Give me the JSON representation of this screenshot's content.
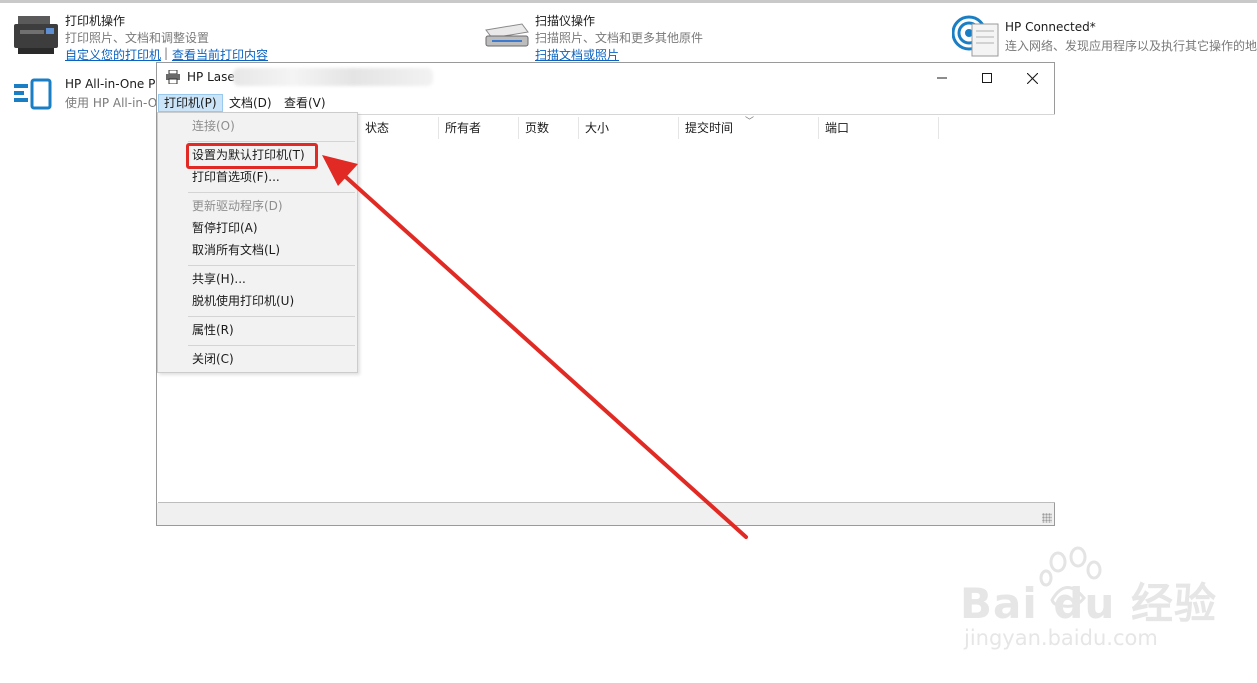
{
  "tiles": {
    "printer_actions": {
      "title": "打印机操作",
      "subtitle": "打印照片、文档和调整设置",
      "link1": "自定义您的打印机",
      "link2": "查看当前打印内容",
      "separator": "|"
    },
    "scanner_actions": {
      "title": "扫描仪操作",
      "subtitle": "扫描照片、文档和更多其他原件",
      "link": "扫描文档或照片"
    },
    "hp_connected": {
      "title": "HP Connected*",
      "subtitle": "连入网络、发现应用程序以及执行其它操作的地"
    },
    "hp_allinone": {
      "title": "HP All-in-One P",
      "subtitle": "使用 HP All-in-O"
    }
  },
  "window": {
    "title": "HP Lase",
    "controls": {
      "minimize": "minimize-icon",
      "maximize": "maximize-icon",
      "close": "close-icon"
    },
    "menus": [
      "打印机(P)",
      "文档(D)",
      "查看(V)"
    ],
    "columns": [
      "状态",
      "所有者",
      "页数",
      "大小",
      "提交时间",
      "端口"
    ]
  },
  "dropdown": {
    "items": [
      {
        "label": "连接(O)",
        "disabled": true
      },
      {
        "label": "设置为默认打印机(T)",
        "disabled": false
      },
      {
        "label": "打印首选项(F)...",
        "disabled": false
      },
      {
        "label": "更新驱动程序(D)",
        "disabled": true
      },
      {
        "label": "暂停打印(A)",
        "disabled": false
      },
      {
        "label": "取消所有文档(L)",
        "disabled": false
      },
      {
        "label": "共享(H)...",
        "disabled": false
      },
      {
        "label": "脱机使用打印机(U)",
        "disabled": false
      },
      {
        "label": "属性(R)",
        "disabled": false
      },
      {
        "label": "关闭(C)",
        "disabled": false
      }
    ]
  },
  "annotation": {
    "color": "#e02a23"
  },
  "watermark": {
    "brand": "Bai du 经验",
    "url": "jingyan.baidu.com"
  },
  "colors": {
    "link": "#0b63c1",
    "menu_active_bg": "#cce4f7",
    "menu_bg": "#f2f2f2"
  }
}
